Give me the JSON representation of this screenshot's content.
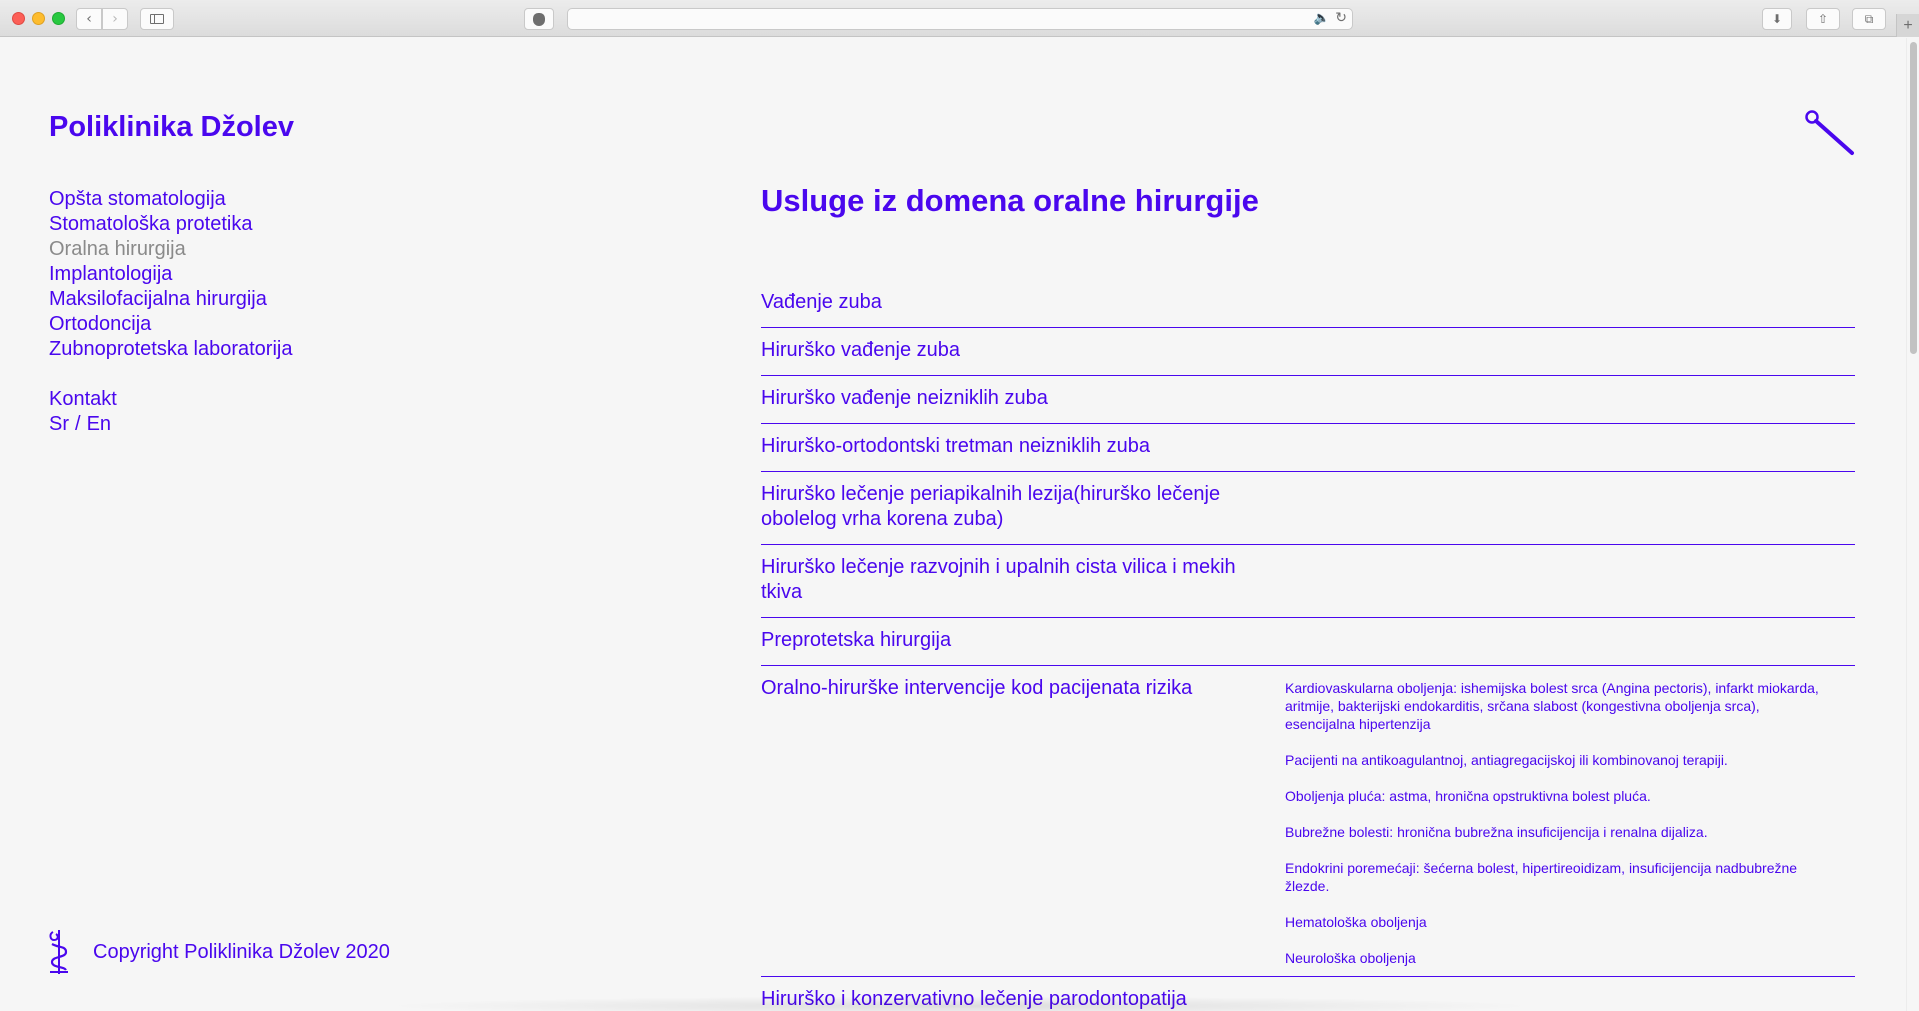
{
  "browser": {
    "back_glyph": "‹",
    "forward_glyph": "›",
    "audio_glyph": "🔈",
    "reload_glyph": "↻",
    "download_glyph": "⬇",
    "share_glyph": "⇧",
    "tabs_glyph": "⧉",
    "newtab_glyph": "+"
  },
  "site": {
    "title": "Poliklinika Džolev",
    "search_icon": "search-icon",
    "accent_color": "#4a07ee",
    "active_color": "#8a8a8a"
  },
  "nav": {
    "items": [
      {
        "label": "Opšta stomatologija",
        "active": false
      },
      {
        "label": "Stomatološka protetika",
        "active": false
      },
      {
        "label": "Oralna hirurgija",
        "active": true
      },
      {
        "label": "Implantologija",
        "active": false
      },
      {
        "label": "Maksilofacijalna hirurgija",
        "active": false
      },
      {
        "label": "Ortodoncija",
        "active": false
      },
      {
        "label": "Zubnoprotetska laboratorija",
        "active": false
      }
    ],
    "contact": "Kontakt",
    "lang_sr": "Sr",
    "lang_sep": "/",
    "lang_en": "En"
  },
  "main": {
    "heading": "Usluge iz domena oralne hirurgije",
    "services": [
      {
        "title": "Vađenje zuba"
      },
      {
        "title": "Hirurško vađenje zuba"
      },
      {
        "title": "Hirurško vađenje neizniklih zuba"
      },
      {
        "title": "Hirurško-ortodontski tretman neizniklih zuba"
      },
      {
        "title": "Hirurško lečenje periapikalnih lezija(hirurško lečenje obolelog vrha korena zuba)"
      },
      {
        "title": "Hirurško lečenje razvojnih i upalnih cista vilica i mekih tkiva"
      },
      {
        "title": "Preprotetska hirurgija"
      },
      {
        "title": "Oralno-hirurške intervencije kod pacijenata rizika",
        "details": [
          "Kardiovaskularna oboljenja: ishemijska bolest srca (Angina pectoris), infarkt miokarda, aritmije, bakterijski endokarditis, srčana slabost (kongestivna oboljenja srca), esencijalna hipertenzija",
          "Pacijenti na antikoagulantnoj, antiagregacijskoj ili kombinovanoj terapiji.",
          "Oboljenja pluća: astma, hronična opstruktivna bolest pluća.",
          "Bubrežne bolesti: hronična bubrežna insuficijencija i renalna dijaliza.",
          "Endokrini poremećaji: šećerna bolest, hipertireoidizam, insuficijencija nadbubrežne žlezde.",
          "Hematološka oboljenja",
          "Neurološka oboljenja"
        ]
      },
      {
        "title": "Hirurško i konzervativno lečenje parodontopatija"
      }
    ]
  },
  "footer": {
    "logo_icon": "caduceus-tooth-icon",
    "copyright": "Copyright Poliklinika Džolev 2020"
  }
}
